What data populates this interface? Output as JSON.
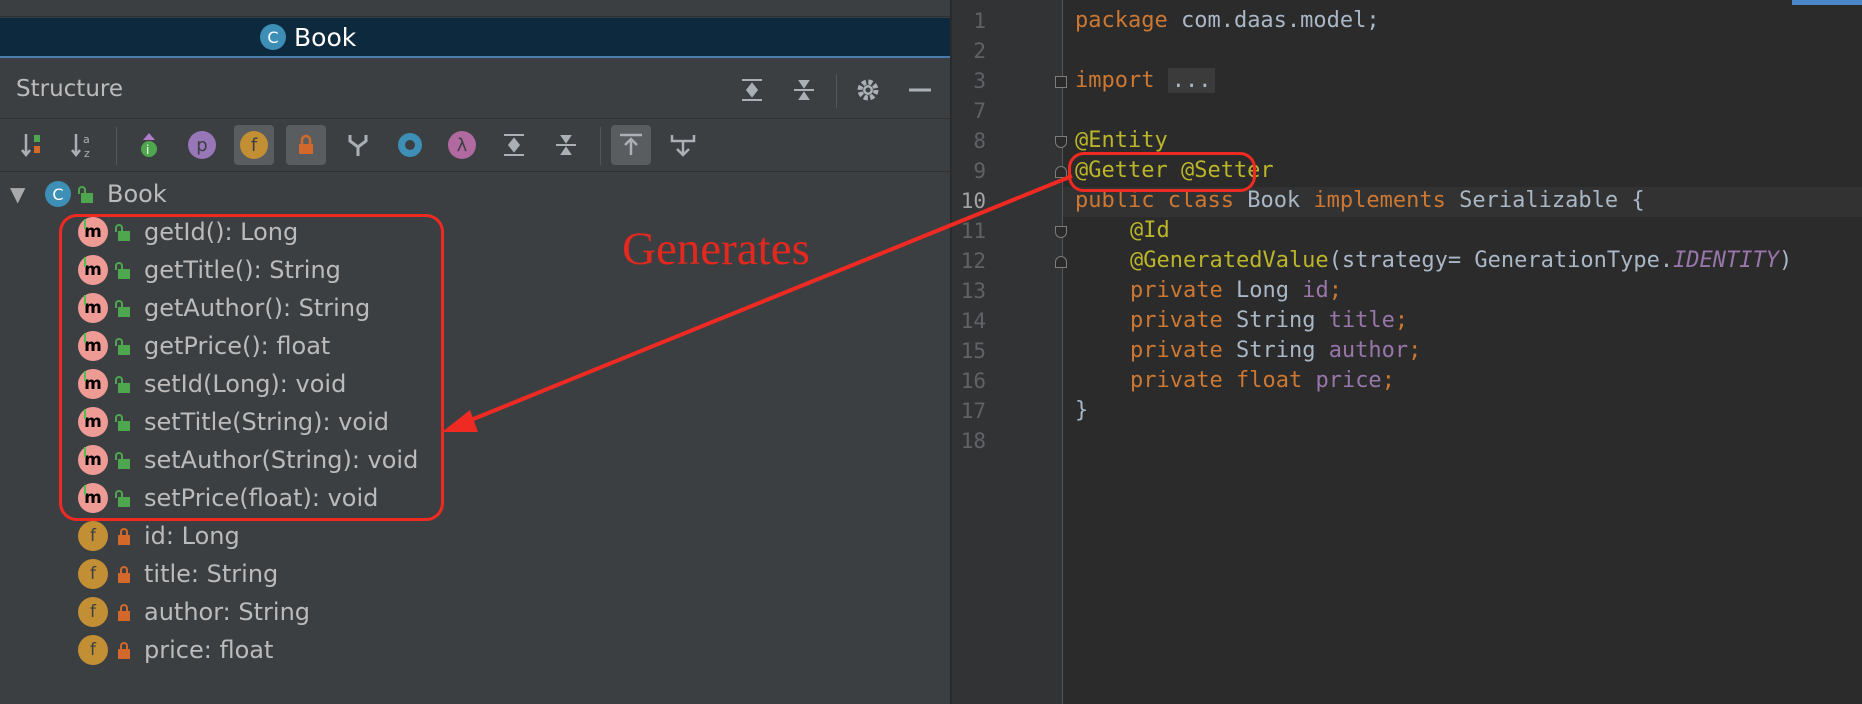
{
  "editor_tab": {
    "class_badge": "C",
    "title": "Book"
  },
  "structure": {
    "title": "Structure",
    "root": {
      "badge": "C",
      "label": "Book"
    },
    "methods": [
      "getId(): Long",
      "getTitle(): String",
      "getAuthor(): String",
      "getPrice(): float",
      "setId(Long): void",
      "setTitle(String): void",
      "setAuthor(String): void",
      "setPrice(float): void"
    ],
    "method_badge": "m",
    "fields": [
      "id: Long",
      "title: String",
      "author: String",
      "price: float"
    ],
    "field_badge": "f"
  },
  "toolbar_icons": [
    "sort-by-visibility-icon",
    "sort-alphabetically-icon",
    "show-inherited-icon",
    "show-properties-icon",
    "show-fields-icon",
    "show-non-public-icon",
    "show-anonymous-icon",
    "show-lambdas-icon",
    "expand-all-icon",
    "collapse-all-icon",
    "autoscroll-to-source-icon",
    "autoscroll-from-source-icon"
  ],
  "toolbar_badges": {
    "properties": "p",
    "fields": "f",
    "lambdas": "λ"
  },
  "annotation": {
    "text": "Generates"
  },
  "code": {
    "line_numbers": [
      "1",
      "2",
      "3",
      "7",
      "8",
      "9",
      "10",
      "11",
      "12",
      "13",
      "14",
      "15",
      "16",
      "17",
      "18"
    ],
    "current_line": "10",
    "lines": {
      "l1_kw": "package",
      "l1_rest": " com.daas.model;",
      "l3_kw": "import",
      "l3_fold": "...",
      "l8": "@Entity",
      "l9": "@Getter @Setter",
      "l10_kw": "public class",
      "l10_name": " Book ",
      "l10_impl": "implements",
      "l10_rest": " Serializable {",
      "l11": "@Id",
      "l12_an": "@GeneratedValue",
      "l12_mid": "(strategy= GenerationType.",
      "l12_const": "IDENTITY",
      "l12_end": ")",
      "l13_kw": "private",
      "l13_type": " Long ",
      "l13_name": "id",
      "l13_end": ";",
      "l14_kw": "private",
      "l14_type": " String ",
      "l14_name": "title",
      "l14_end": ";",
      "l15_kw": "private",
      "l15_type": " String ",
      "l15_name": "author",
      "l15_end": ";",
      "l16_kw": "private",
      "l16_type1": " float",
      "l16_type2": " ",
      "l16_name": "price",
      "l16_end": ";",
      "l17": "}"
    }
  },
  "colors": {
    "annotation_red": "#ef2a22",
    "keyword": "#cc7832",
    "annotation": "#bbb529",
    "field": "#9876aa"
  }
}
